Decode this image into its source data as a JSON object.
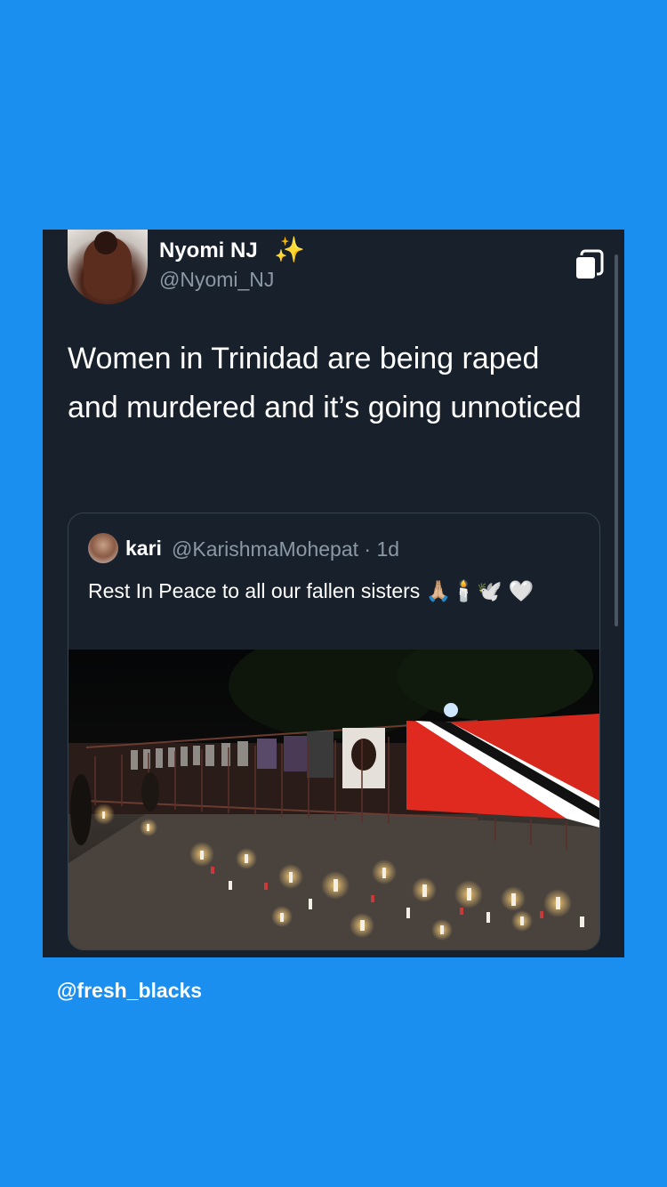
{
  "tweet": {
    "display_name": "Nyomi NJ",
    "name_emoji": "✨",
    "handle": "@Nyomi_NJ",
    "text": "Women in Trinidad are being raped and murdered and it’s going unnoticed"
  },
  "quoted_tweet": {
    "display_name": "kari",
    "handle": "@KarishmaMohepat",
    "separator": "·",
    "age": "1d",
    "text": "Rest In Peace to all our fallen sisters",
    "emojis": "🙏🏼🕯️🕊️ 🤍"
  },
  "watermark": "@fresh_blacks",
  "icons": {
    "copy": "copy-icon",
    "sparkle": "sparkles-icon"
  },
  "colors": {
    "background": "#1a8ff0",
    "card": "#17202b",
    "secondary_text": "#8b98a5",
    "border": "#38444d"
  }
}
